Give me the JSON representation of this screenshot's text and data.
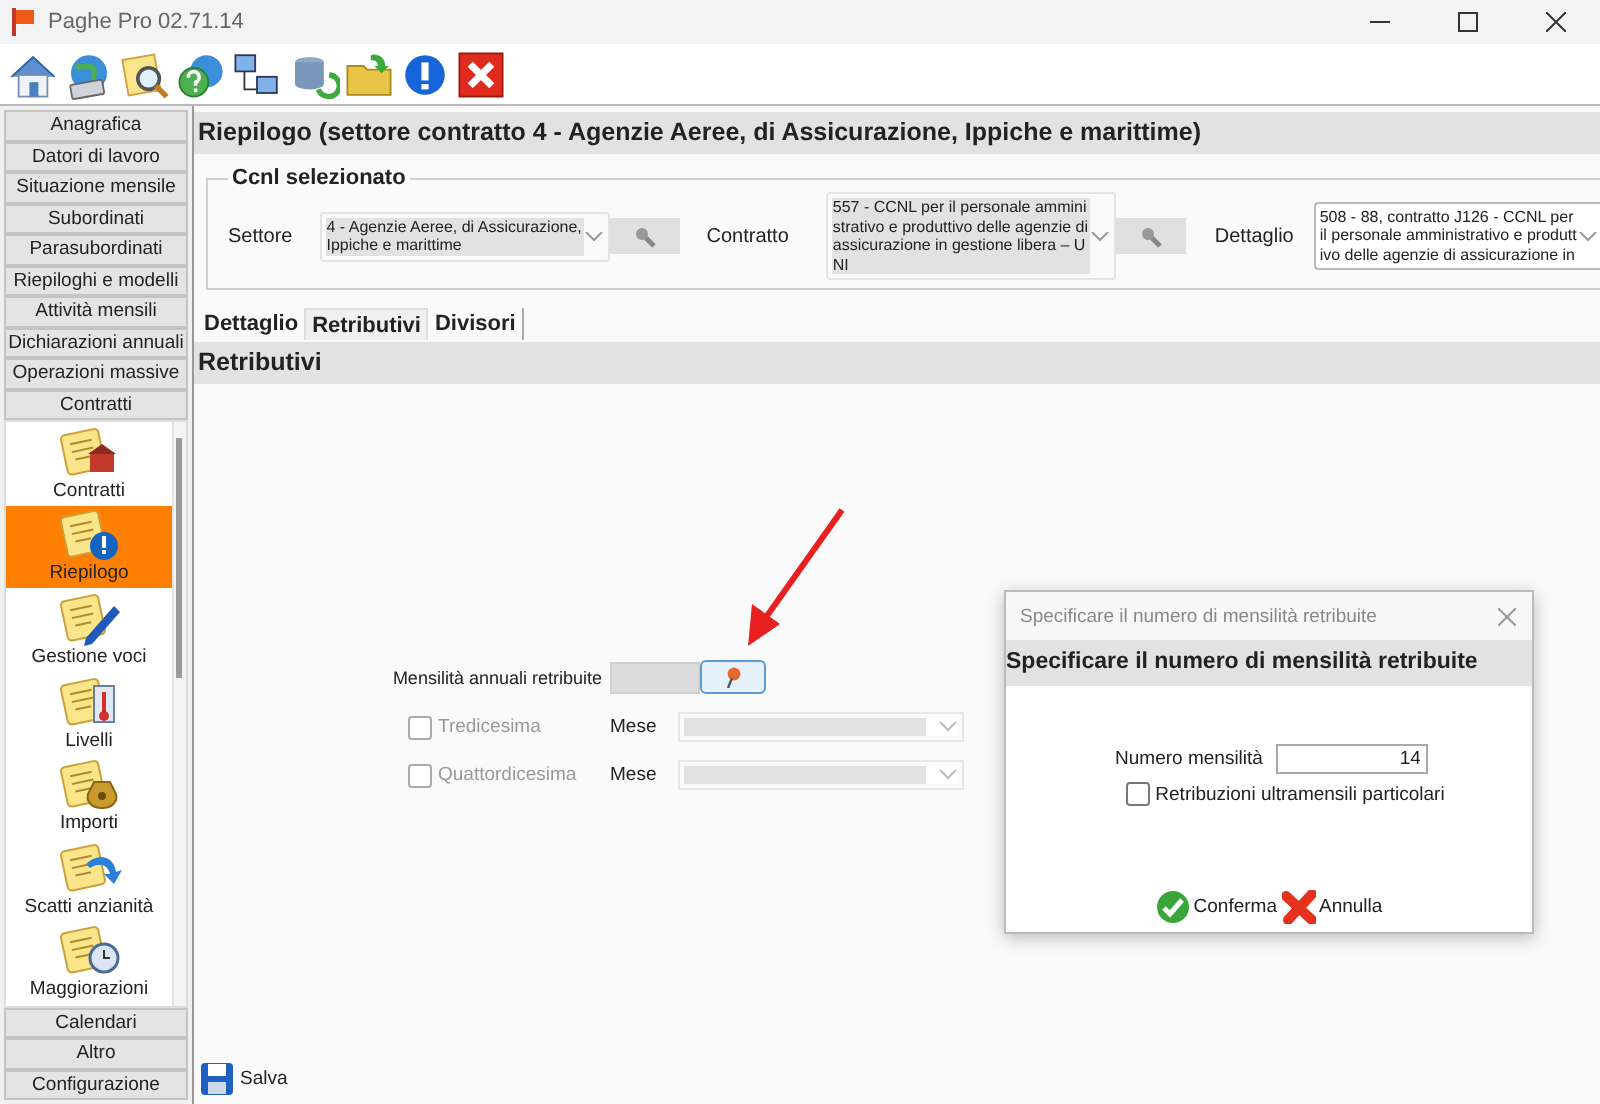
{
  "window": {
    "title": "Paghe Pro 02.71.14"
  },
  "sidebar": {
    "sections_top": [
      "Anagrafica",
      "Datori di lavoro",
      "Situazione mensile",
      "Subordinati",
      "Parasubordinati",
      "Riepiloghi e modelli",
      "Attività mensili",
      "Dichiarazioni annuali",
      "Operazioni massive"
    ],
    "open_section": {
      "label": "Contratti",
      "items": [
        {
          "label": "Contratti",
          "selected": false
        },
        {
          "label": "Riepilogo",
          "selected": true
        },
        {
          "label": "Gestione voci",
          "selected": false
        },
        {
          "label": "Livelli",
          "selected": false
        },
        {
          "label": "Importi",
          "selected": false
        },
        {
          "label": "Scatti anzianità",
          "selected": false
        },
        {
          "label": "Maggiorazioni",
          "selected": false
        }
      ]
    },
    "sections_bottom": [
      "Calendari",
      "Altro",
      "Configurazione"
    ]
  },
  "content": {
    "title": "Riepilogo (settore contratto 4 - Agenzie Aeree, di Assicurazione, Ippiche e marittime)",
    "ccnl": {
      "legend": "Ccnl selezionato",
      "fields": [
        {
          "label": "Settore",
          "value": "4 - Agenzie Aeree, di Assicurazione, Ippiche e marittime",
          "lookup": true
        },
        {
          "label": "Contratto",
          "value": "557 - CCNL per il personale amministrativo e produttivo delle agenzie di assicurazione in gestione libera – UNI",
          "lookup": true
        },
        {
          "label": "Dettaglio",
          "value": "508 - 88, contratto J126 - CCNL per il personale amministrativo e produttivo delle agenzie di assicurazione in",
          "lookup": false
        }
      ]
    },
    "tabs": [
      {
        "label": "Dettaglio",
        "selected": false
      },
      {
        "label": "Retributivi",
        "selected": true
      },
      {
        "label": "Divisori",
        "selected": false
      }
    ],
    "section_title": "Retributivi",
    "form": {
      "mensilita_label": "Mensilità annuali retribuite",
      "options": [
        {
          "label": "Tredicesima",
          "checked": false,
          "disabled": true,
          "month_label": "Mese"
        },
        {
          "label": "Quattordicesima",
          "checked": false,
          "disabled": true,
          "month_label": "Mese"
        }
      ]
    },
    "save_button": "Salva"
  },
  "dialog": {
    "title": "Specificare il numero di mensilità retribuite",
    "heading": "Specificare il numero di mensilità retribuite",
    "field_label": "Numero mensilità",
    "value": "14",
    "checkbox": {
      "label": "Retribuzioni ultramensili particolari",
      "checked": false
    },
    "buttons": [
      {
        "label": "Conferma",
        "kind": "confirm"
      },
      {
        "label": "Annulla",
        "kind": "cancel"
      }
    ]
  }
}
